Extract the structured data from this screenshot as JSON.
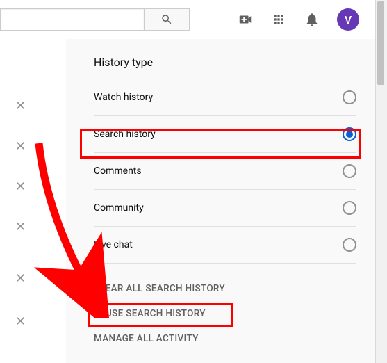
{
  "header": {
    "search_value": "",
    "search_placeholder": "",
    "avatar_letter": "V"
  },
  "panel": {
    "title": "History type",
    "options": [
      {
        "label": "Watch history",
        "selected": false
      },
      {
        "label": "Search history",
        "selected": true
      },
      {
        "label": "Comments",
        "selected": false
      },
      {
        "label": "Community",
        "selected": false
      },
      {
        "label": "Live chat",
        "selected": false
      }
    ],
    "actions": {
      "clear": "CLEAR ALL SEARCH HISTORY",
      "pause": "PAUSE SEARCH HISTORY",
      "manage": "MANAGE ALL ACTIVITY"
    }
  },
  "left_col": {
    "delete_icon": "✕"
  }
}
